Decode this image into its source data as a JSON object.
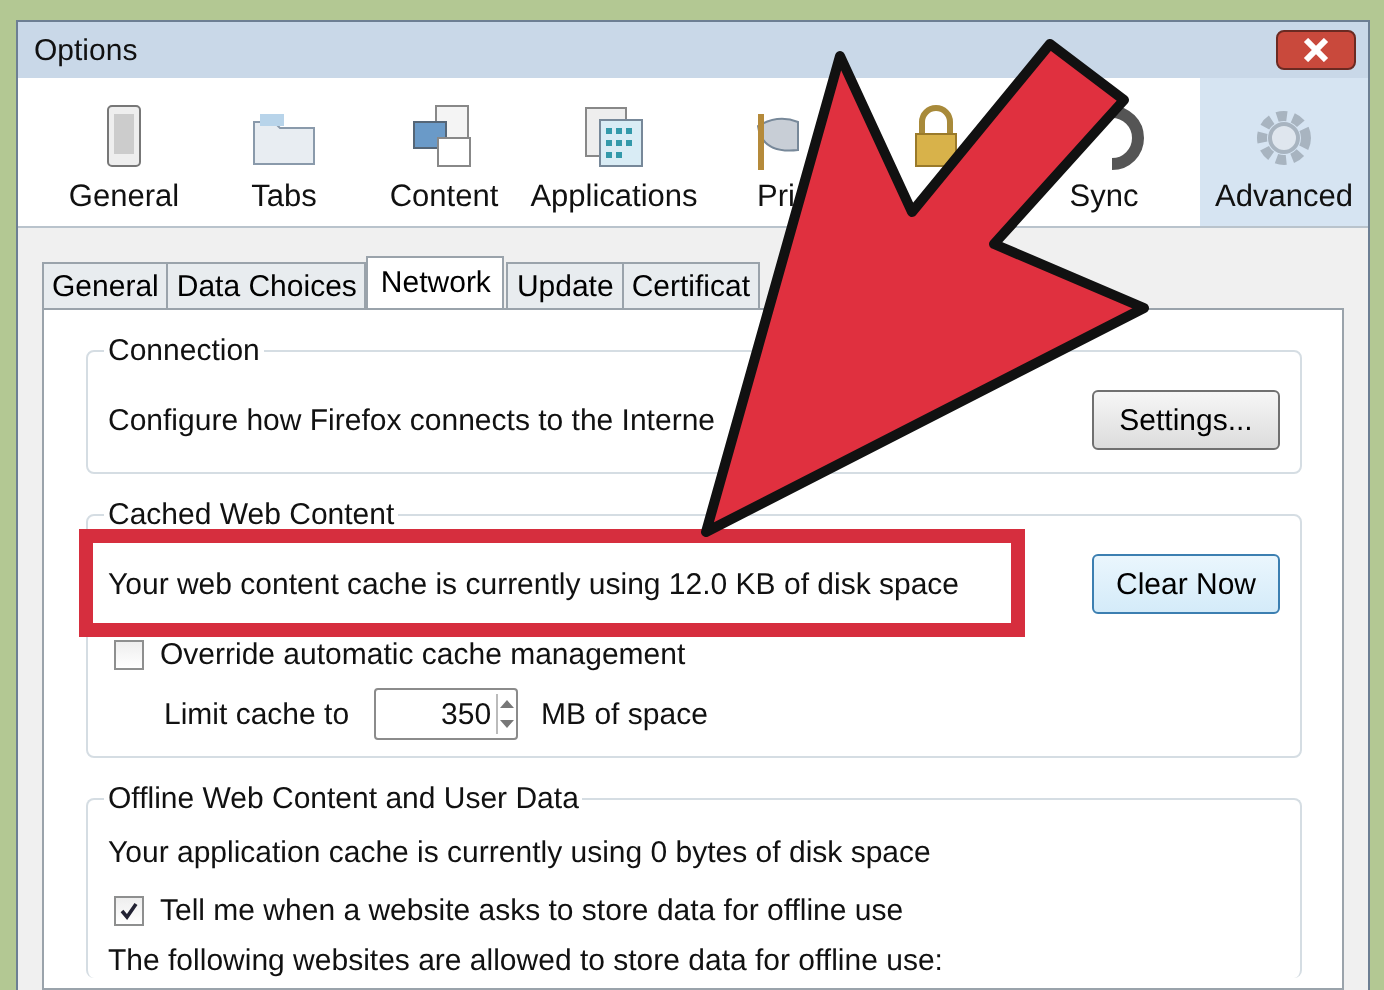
{
  "window": {
    "title": "Options"
  },
  "toolbar": [
    {
      "kind": "device",
      "label": "General",
      "selected": false
    },
    {
      "kind": "folder",
      "label": "Tabs",
      "selected": false
    },
    {
      "kind": "content",
      "label": "Content",
      "selected": false
    },
    {
      "kind": "apps",
      "label": "Applications",
      "selected": false
    },
    {
      "kind": "mask",
      "label": "Pri",
      "selected": false
    },
    {
      "kind": "lock",
      "selected": false
    },
    {
      "kind": "sync",
      "label": "Sync",
      "selected": false
    },
    {
      "kind": "gear",
      "label": "Advanced",
      "selected": true
    }
  ],
  "tabs": [
    {
      "label": "General",
      "selected": false
    },
    {
      "label": "Data Choices",
      "selected": false
    },
    {
      "label": "Network",
      "selected": true
    },
    {
      "label": "Update",
      "selected": false
    },
    {
      "label": "Certificat",
      "selected": false
    }
  ],
  "connection": {
    "title": "Connection",
    "text": "Configure how Firefox connects to the Interne",
    "button": "Settings..."
  },
  "cache": {
    "title": "Cached Web Content",
    "text": "Your web content cache is currently using 12.0 KB of disk space",
    "button": "Clear Now",
    "override": {
      "label": "Override automatic cache management",
      "checked": false
    },
    "limit": {
      "label": "Limit cache to",
      "value": "350",
      "unit": "MB of space"
    }
  },
  "offline": {
    "title": "Offline Web Content and User Data",
    "text": "Your application cache is currently using 0 bytes of disk space",
    "notify": {
      "label": "Tell me when a website asks to store data for offline use",
      "checked": true
    },
    "list_label": "The following websites are allowed to store data for offline use:"
  }
}
